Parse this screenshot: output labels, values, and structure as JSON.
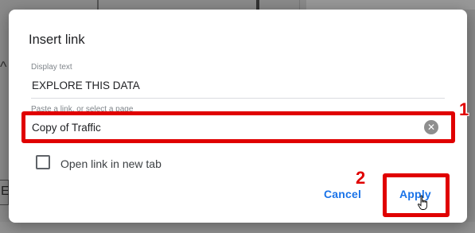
{
  "dialog": {
    "title": "Insert link",
    "display_text": {
      "label": "Display text",
      "value": "EXPLORE THIS DATA"
    },
    "link": {
      "label": "Paste a link, or select a page",
      "value": "Copy of Traffic"
    },
    "new_tab": {
      "label": "Open link in new tab",
      "checked": false
    },
    "cancel_label": "Cancel",
    "apply_label": "Apply"
  },
  "annotations": {
    "step_1": "1",
    "step_2": "2",
    "highlight_color": "#e00000"
  },
  "background": {
    "letter": "E",
    "chevron": "^"
  }
}
